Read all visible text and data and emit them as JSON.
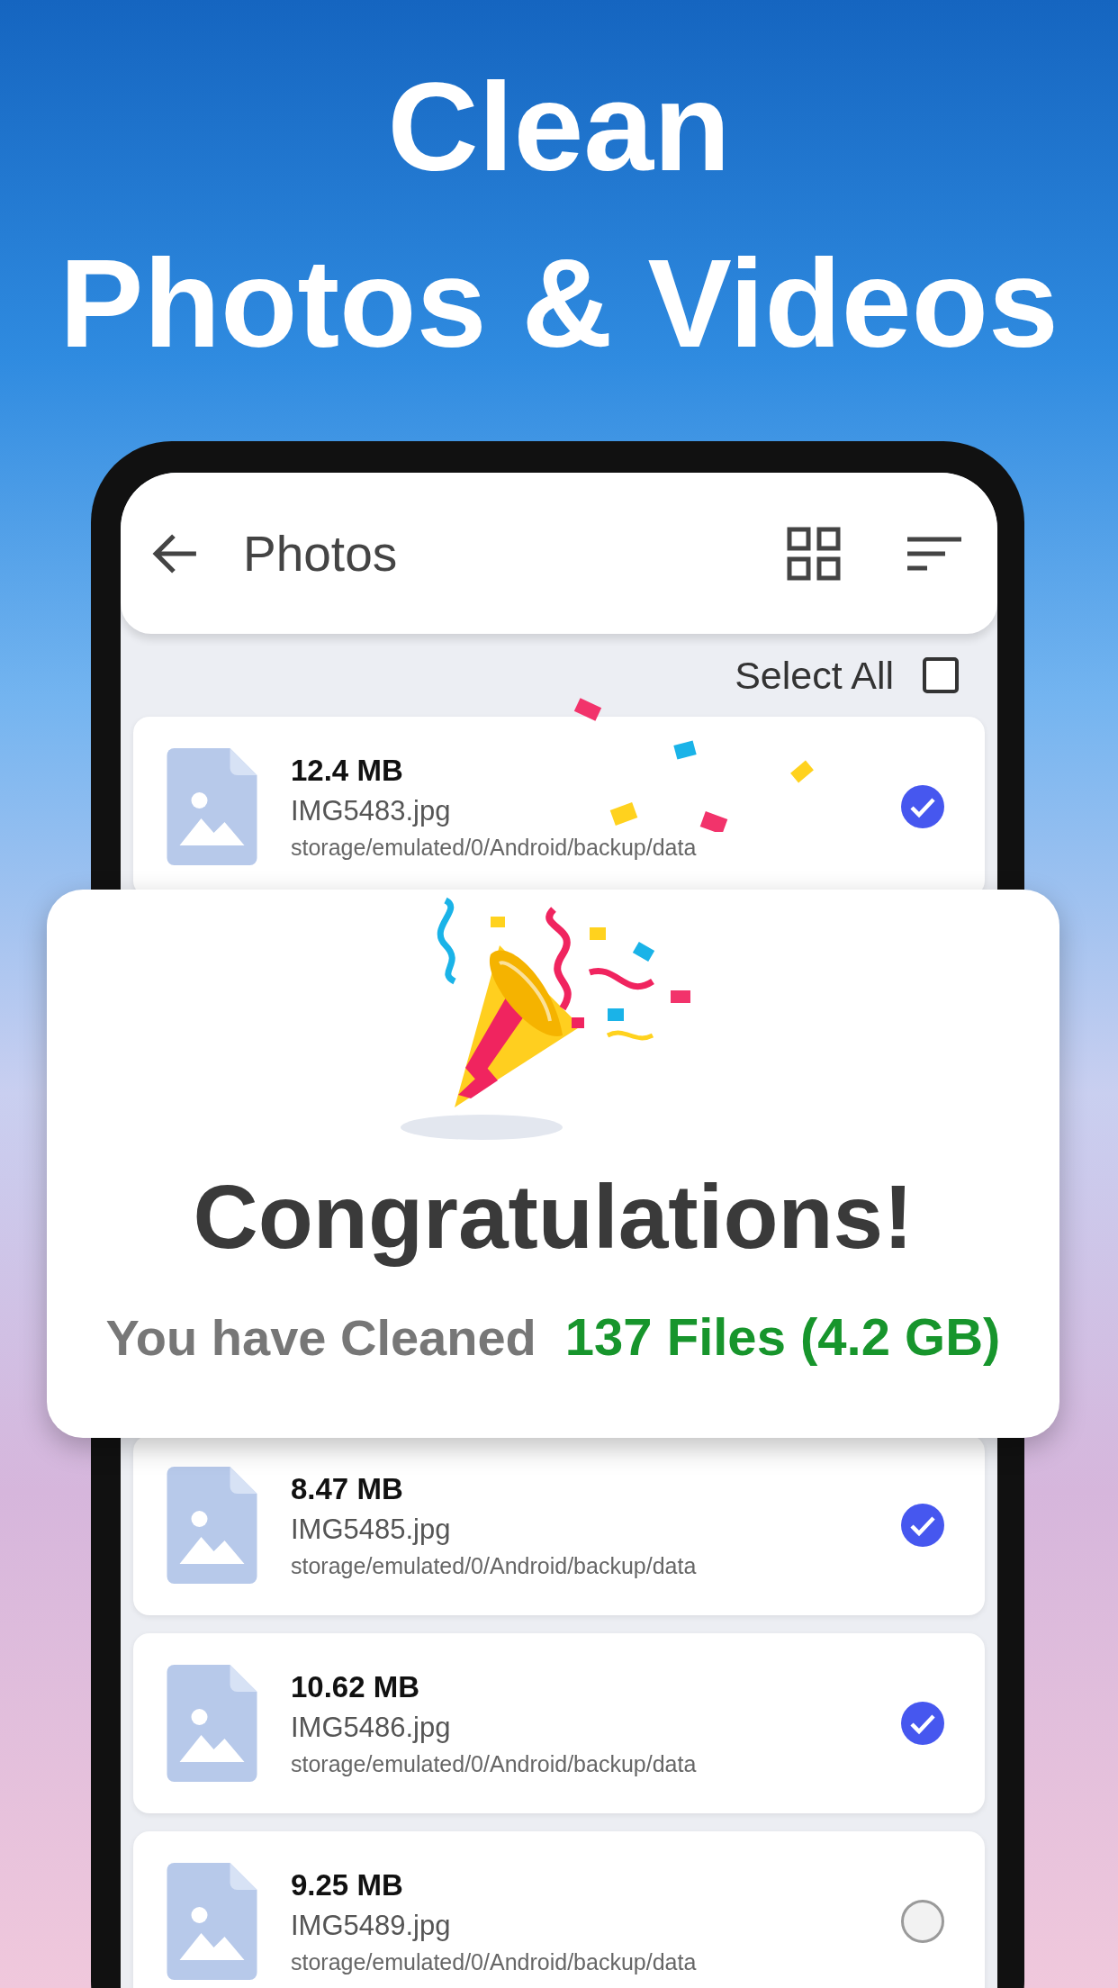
{
  "headline": [
    "Clean",
    "Photos & Videos"
  ],
  "app_bar": {
    "title": "Photos"
  },
  "select_all": {
    "label": "Select All",
    "checked": false
  },
  "files_top": [
    {
      "size": "12.4 MB",
      "name": "IMG5483.jpg",
      "path": "storage/emulated/0/Android/backup/data",
      "selected": true
    }
  ],
  "files_bottom": [
    {
      "size": "8.47 MB",
      "name": "IMG5485.jpg",
      "path": "storage/emulated/0/Android/backup/data",
      "selected": true
    },
    {
      "size": "10.62 MB",
      "name": "IMG5486.jpg",
      "path": "storage/emulated/0/Android/backup/data",
      "selected": true
    },
    {
      "size": "9.25 MB",
      "name": "IMG5489.jpg",
      "path": "storage/emulated/0/Android/backup/data",
      "selected": false
    }
  ],
  "dialog": {
    "title": "Congratulations!",
    "message": "You have Cleaned",
    "result": "137 Files (4.2 GB)"
  }
}
